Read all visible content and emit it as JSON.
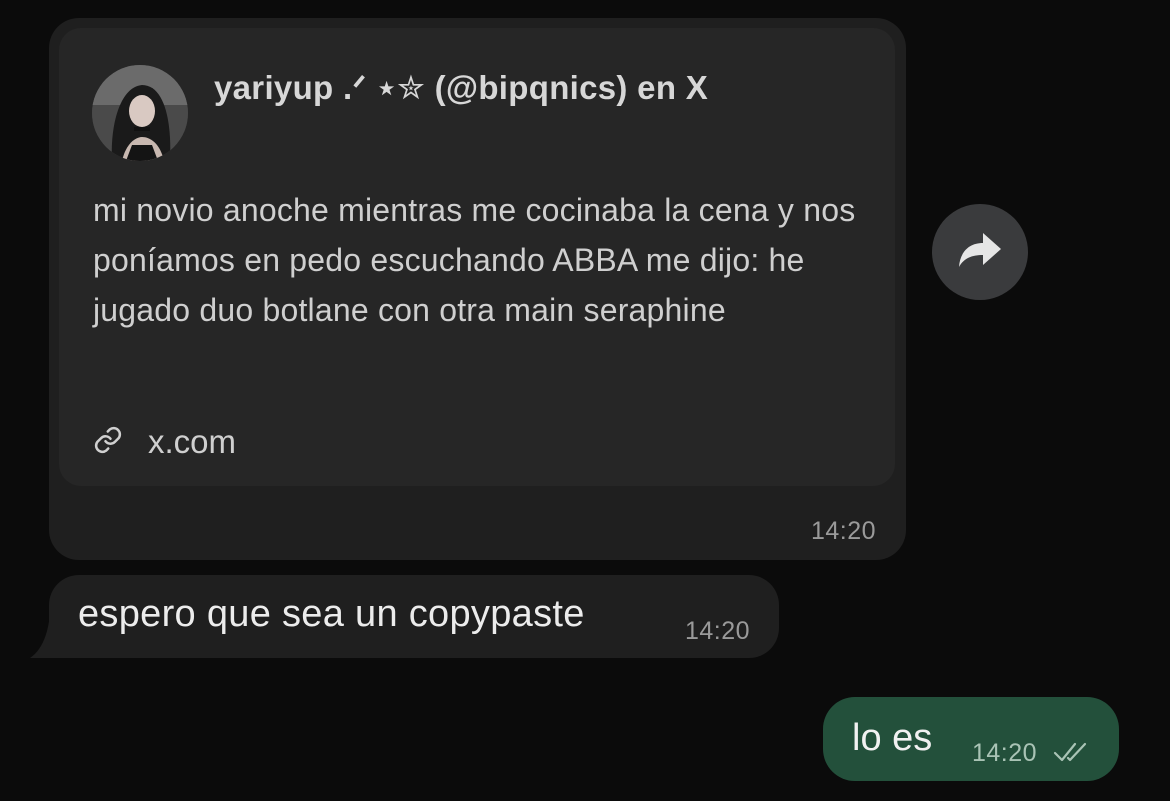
{
  "preview": {
    "title": "yariyup .ᐟ ⋆✮ (@bipqnics) en X",
    "body": "mi novio anoche mientras me cocinaba la cena y nos poníamos en pedo escuchando ABBA me dijo: he jugado duo botlane con otra main seraphine",
    "link_label": "x.com",
    "link_icon": "link-icon",
    "time": "14:20"
  },
  "forward": {
    "icon": "forward-arrow-icon"
  },
  "incoming_message": {
    "text": "espero que sea un copypaste",
    "time": "14:20"
  },
  "outgoing_message": {
    "text": "lo es",
    "time": "14:20",
    "status_icon": "double-check-icon"
  },
  "colors": {
    "background": "#0b0b0b",
    "incoming_bubble": "#1f1f1f",
    "preview_card": "#262626",
    "outgoing_bubble": "#23503b",
    "forward_button": "#3a3b3d"
  }
}
